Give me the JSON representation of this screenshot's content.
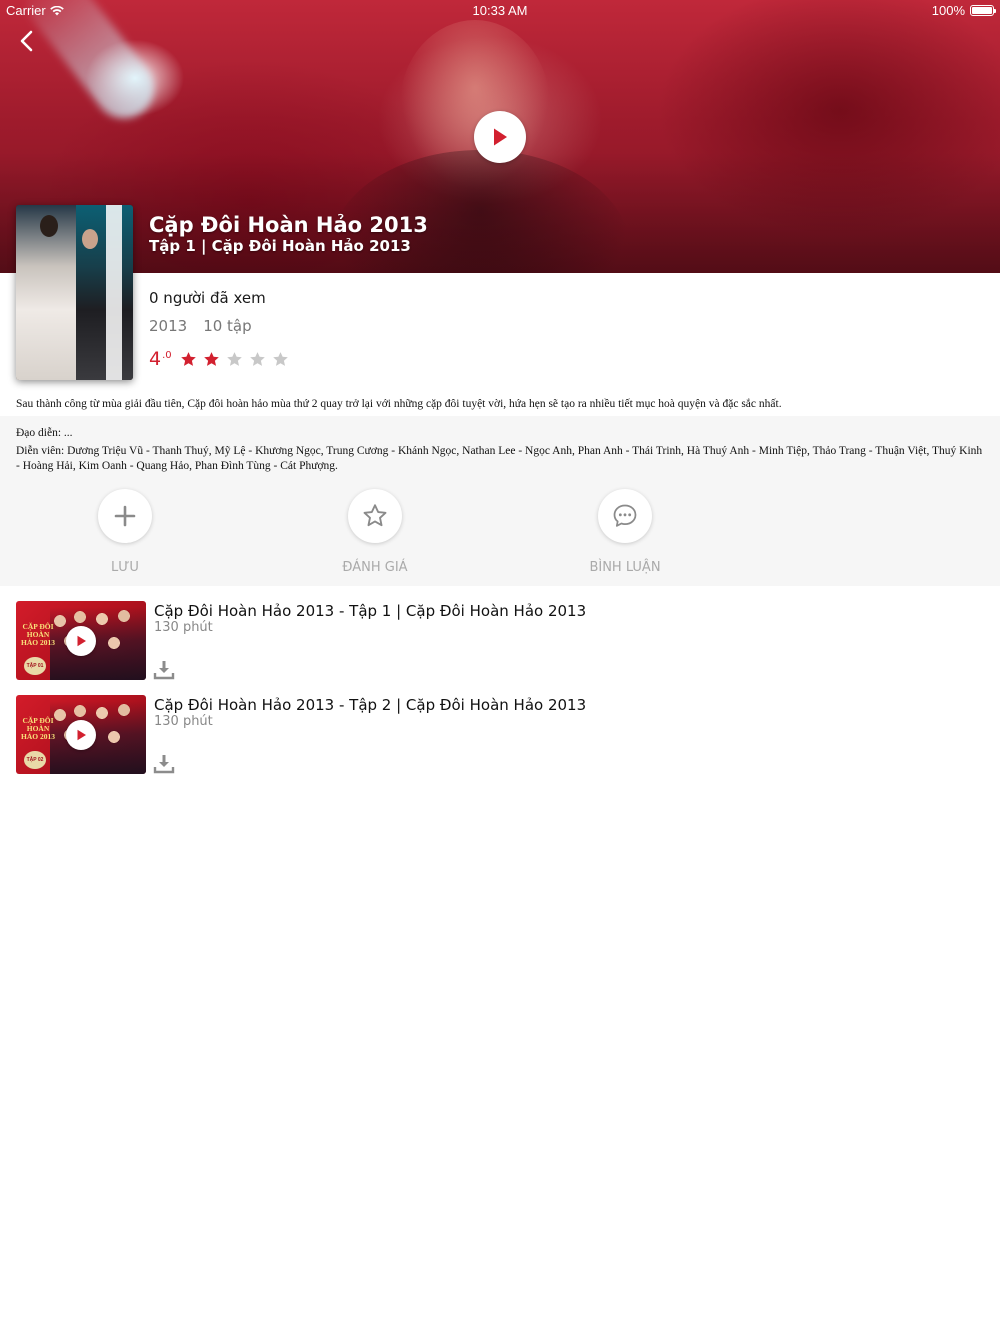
{
  "status_bar": {
    "carrier": "Carrier",
    "time": "10:33 AM",
    "battery": "100%"
  },
  "hero": {
    "title": "Cặp Đôi Hoàn Hảo 2013",
    "subtitle": "Tập 1 | Cặp Đôi Hoàn Hảo 2013"
  },
  "info": {
    "views": "0 người đã xem",
    "year": "2013",
    "episodes_count": "10 tập",
    "rating_score": "4",
    "rating_decimal": ".0",
    "stars_filled": 2,
    "stars_total": 5
  },
  "description": "Sau thành công từ mùa giải đầu tiên, Cặp đôi hoàn hảo mùa thứ 2 quay trở lại với những cặp đôi tuyệt vời, hứa hẹn sẽ tạo ra nhiều tiết mục hoà quyện và đặc sắc nhất.",
  "cast": {
    "director": "Đạo diễn: ...",
    "actors": "Diễn viên: Dương Triệu Vũ - Thanh Thuý, Mỹ Lệ - Khương Ngọc, Trung Cương - Khánh Ngọc, Nathan Lee - Ngọc Anh, Phan Anh - Thái Trinh, Hà Thuý Anh - Minh Tiệp, Thảo Trang - Thuận Việt, Thuý Kinh - Hoàng Hải, Kim Oanh - Quang Hảo, Phan Đình Tùng - Cát Phượng."
  },
  "actions": {
    "save_label": "LƯU",
    "rate_label": "ĐÁNH GIÁ",
    "comment_label": "BÌNH LUẬN"
  },
  "episodes": [
    {
      "title": "Cặp Đôi Hoàn Hảo 2013 - Tập 1 | Cặp Đôi Hoàn Hảo 2013",
      "duration": "130 phút",
      "thumb_text": "CẶP ĐÔI HOÀN HẢO 2013",
      "badge": "TẬP 01"
    },
    {
      "title": "Cặp Đôi Hoàn Hảo 2013 - Tập 2 | Cặp Đôi Hoàn Hảo 2013",
      "duration": "130 phút",
      "thumb_text": "CẶP ĐÔI HOÀN HẢO 2013",
      "badge": "TẬP 02"
    }
  ],
  "colors": {
    "accent": "#d2202f",
    "star_empty": "#c8c8c8",
    "panel_bg": "#f6f6f6"
  },
  "icons": {
    "back": "chevron-left-icon",
    "play": "play-icon",
    "save": "plus-icon",
    "rate": "star-outline-icon",
    "comment": "chat-bubble-icon",
    "download": "download-icon"
  }
}
